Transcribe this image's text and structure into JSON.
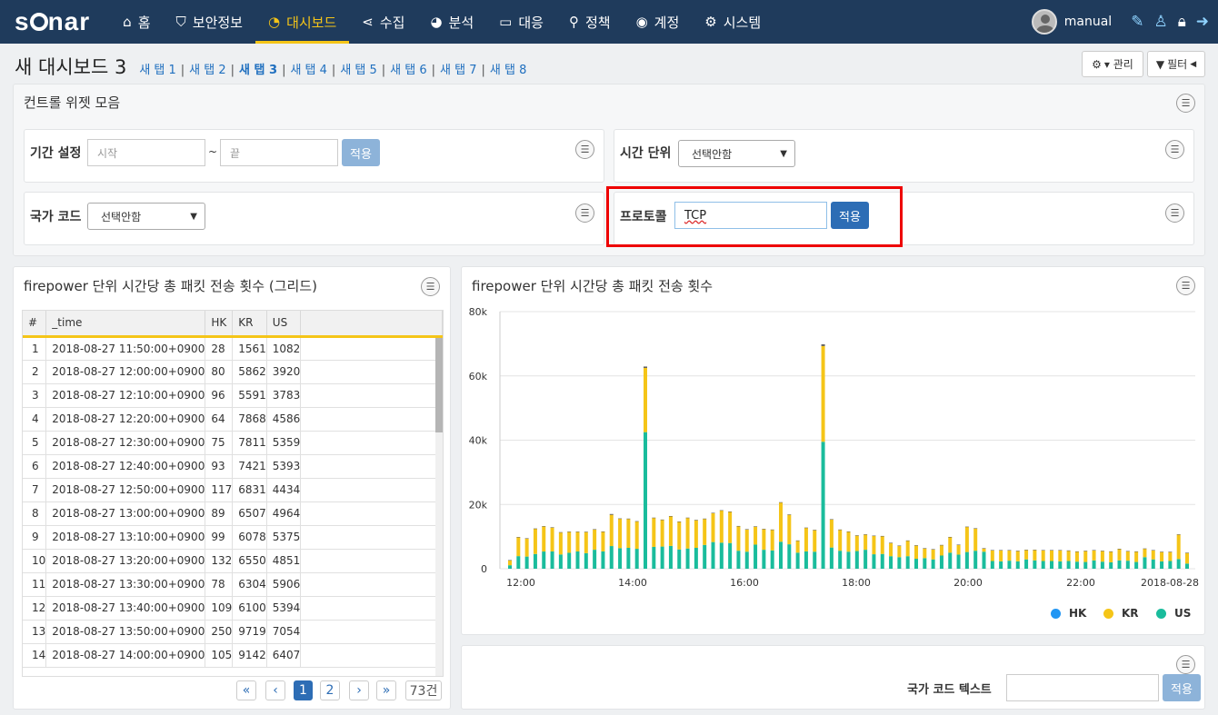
{
  "nav": {
    "logo": "s nar",
    "items": [
      {
        "label": "홈",
        "icon": "home-icon",
        "glyph": "⌂"
      },
      {
        "label": "보안정보",
        "icon": "shield-icon",
        "glyph": "⛉"
      },
      {
        "label": "대시보드",
        "icon": "dashboard-gauge-icon",
        "glyph": "◔",
        "active": true
      },
      {
        "label": "수집",
        "icon": "share-icon",
        "glyph": "⋖"
      },
      {
        "label": "분석",
        "icon": "pie-chart-icon",
        "glyph": "◕"
      },
      {
        "label": "대응",
        "icon": "monitor-icon",
        "glyph": "▭"
      },
      {
        "label": "정책",
        "icon": "search-icon",
        "glyph": "⚲"
      },
      {
        "label": "계정",
        "icon": "user-circle-icon",
        "glyph": "◉"
      },
      {
        "label": "시스템",
        "icon": "gear-icon",
        "glyph": "⚙"
      }
    ],
    "user": "manual"
  },
  "title": "새 대시보드 3",
  "tabs": [
    "새 탭 1",
    "새 탭 2",
    "새 탭 3",
    "새 탭 4",
    "새 탭 5",
    "새 탭 6",
    "새 탭 7",
    "새 탭 8"
  ],
  "current_tab": 2,
  "toolbar": {
    "manage": "▾ 관리",
    "filter": "필터"
  },
  "controls": {
    "panel_title": "컨트롤 위젯 모음",
    "period_label": "기간 설정",
    "start_placeholder": "시작",
    "tilde": "~",
    "end_placeholder": "끝",
    "apply": "적용",
    "time_unit_label": "시간 단위",
    "time_unit_value": "선택안함",
    "country_label": "국가 코드",
    "country_value": "선택안함",
    "protocol_label": "프로토콜",
    "protocol_value": "TCP"
  },
  "grid": {
    "title": "firepower 단위 시간당 총 패킷 전송 횟수 (그리드)",
    "columns": [
      "#",
      "_time",
      "HK",
      "KR",
      "US"
    ],
    "rows": [
      [
        "1",
        "2018-08-27 11:50:00+0900",
        "28",
        "1561",
        "1082"
      ],
      [
        "2",
        "2018-08-27 12:00:00+0900",
        "80",
        "5862",
        "3920"
      ],
      [
        "3",
        "2018-08-27 12:10:00+0900",
        "96",
        "5591",
        "3783"
      ],
      [
        "4",
        "2018-08-27 12:20:00+0900",
        "64",
        "7868",
        "4586"
      ],
      [
        "5",
        "2018-08-27 12:30:00+0900",
        "75",
        "7811",
        "5359"
      ],
      [
        "6",
        "2018-08-27 12:40:00+0900",
        "93",
        "7421",
        "5393"
      ],
      [
        "7",
        "2018-08-27 12:50:00+0900",
        "117",
        "6831",
        "4434"
      ],
      [
        "8",
        "2018-08-27 13:00:00+0900",
        "89",
        "6507",
        "4964"
      ],
      [
        "9",
        "2018-08-27 13:10:00+0900",
        "99",
        "6078",
        "5375"
      ],
      [
        "10",
        "2018-08-27 13:20:00+0900",
        "132",
        "6550",
        "4851"
      ],
      [
        "11",
        "2018-08-27 13:30:00+0900",
        "78",
        "6304",
        "5906"
      ],
      [
        "12",
        "2018-08-27 13:40:00+0900",
        "109",
        "6100",
        "5394"
      ],
      [
        "13",
        "2018-08-27 13:50:00+0900",
        "250",
        "9719",
        "7054"
      ],
      [
        "14",
        "2018-08-27 14:00:00+0900",
        "105",
        "9142",
        "6407"
      ]
    ],
    "pagination": {
      "first": "«",
      "prev": "‹",
      "pages": [
        "1",
        "2"
      ],
      "next": "›",
      "last": "»",
      "count": "73건"
    }
  },
  "chart_panel": {
    "title": "firepower 단위 시간당 총 패킷 전송 횟수"
  },
  "chart_data": {
    "type": "bar",
    "stacked": true,
    "ylim": [
      0,
      80000
    ],
    "yticks": [
      "0",
      "20k",
      "40k",
      "60k",
      "80k"
    ],
    "xticks": [
      "12:00",
      "14:00",
      "16:00",
      "18:00",
      "20:00",
      "22:00",
      "2018-08-28"
    ],
    "legend": {
      "position": "bottom-right",
      "entries": [
        "HK",
        "KR",
        "US"
      ]
    },
    "colors": {
      "HK": "#2196f3",
      "KR": "#f5c518",
      "US": "#1abc9c"
    },
    "series": [
      {
        "name": "US",
        "values": [
          1082,
          3920,
          3783,
          4586,
          5359,
          5393,
          4434,
          4964,
          5375,
          4851,
          5906,
          5394,
          7054,
          6407,
          6500,
          6200,
          42500,
          6800,
          6900,
          7100,
          6000,
          6300,
          6500,
          7400,
          8300,
          8100,
          8000,
          5600,
          5300,
          7500,
          5900,
          5700,
          8400,
          7600,
          5000,
          5400,
          5300,
          39500,
          6600,
          5600,
          5300,
          5500,
          5900,
          4500,
          4600,
          3900,
          3600,
          3900,
          3100,
          3300,
          2900,
          4100,
          5000,
          4400,
          5200,
          5600,
          5300,
          2400,
          2300,
          2500,
          2300,
          2900,
          2600,
          2400,
          2400,
          2300,
          2400,
          2200,
          2100,
          2600,
          2200,
          2000,
          2600,
          2500,
          2100,
          3600,
          2900,
          2300,
          2400,
          3000,
          1600
        ],
        "comment": "approximate"
      },
      {
        "name": "KR",
        "values": [
          1561,
          5862,
          5591,
          7868,
          7811,
          7421,
          6831,
          6507,
          6078,
          6550,
          6304,
          6100,
          9719,
          9142,
          9000,
          8500,
          20000,
          9000,
          8300,
          9200,
          8600,
          9500,
          8600,
          8100,
          9000,
          10000,
          9700,
          7600,
          6900,
          5600,
          6400,
          6400,
          12200,
          9200,
          3700,
          7300,
          6700,
          29800,
          8700,
          6500,
          6200,
          4800,
          4700,
          5700,
          5500,
          4100,
          3500,
          4800,
          4100,
          3000,
          3100,
          3200,
          4800,
          3000,
          7800,
          6900,
          1000,
          3300,
          3400,
          3200,
          3200,
          2900,
          3200,
          3300,
          3300,
          3400,
          3200,
          3100,
          3400,
          3100,
          3300,
          3300,
          3500,
          2900,
          3200,
          2600,
          2800,
          2900,
          2800,
          7600,
          3300
        ]
      },
      {
        "name": "HK",
        "values": [
          28,
          80,
          96,
          64,
          75,
          93,
          117,
          89,
          99,
          132,
          78,
          109,
          250,
          105,
          100,
          100,
          400,
          100,
          100,
          100,
          100,
          100,
          100,
          100,
          100,
          100,
          100,
          100,
          100,
          100,
          100,
          100,
          100,
          100,
          100,
          100,
          100,
          500,
          100,
          100,
          100,
          100,
          100,
          100,
          100,
          100,
          100,
          100,
          100,
          100,
          100,
          100,
          100,
          100,
          100,
          100,
          100,
          100,
          100,
          100,
          100,
          100,
          100,
          100,
          100,
          100,
          100,
          100,
          100,
          100,
          100,
          100,
          100,
          100,
          100,
          100,
          100,
          100,
          100,
          100,
          100
        ]
      }
    ]
  },
  "text_widget": {
    "label": "국가 코드 텍스트",
    "apply": "적용"
  }
}
